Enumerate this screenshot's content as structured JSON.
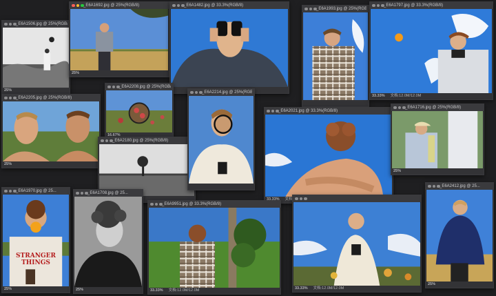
{
  "windows": [
    {
      "title": "_E6A1506.jpg @ 25%(RGB/8)",
      "zoom": "25%",
      "info": ""
    },
    {
      "title": "_E6A1692.jpg @ 25%(RGB/8)",
      "zoom": "25%",
      "info": ""
    },
    {
      "title": "_E6A1482.jpg @ 33.3%(RGB/8)",
      "zoom": "",
      "info": ""
    },
    {
      "title": "_E6A1993.jpg @ 25%(RGB/8)",
      "zoom": "",
      "info": ""
    },
    {
      "title": "_E6A1797.jpg @ 33.3%(RGB/8)",
      "zoom": "33.33%",
      "info": "文档:12.0M/12.0M"
    },
    {
      "title": "_E6A2205.jpg @ 25%(RGB/8)",
      "zoom": "25%",
      "info": ""
    },
    {
      "title": "_E6A2208.jpg @ 25%(RGB/8)",
      "zoom": "16.67%",
      "info": ""
    },
    {
      "title": "_E6A2214.jpg @ 25%(RGB/8)",
      "zoom": "",
      "info": ""
    },
    {
      "title": "_E6A2180.jpg @ 25%(RGB/8)",
      "zoom": "",
      "info": ""
    },
    {
      "title": "_E6A2021.jpg @ 33.3%(RGB/8)",
      "zoom": "33.33%",
      "info": "文档:12.0M/12.0M"
    },
    {
      "title": "_E6A1716.jpg @ 25%(RGB/8)",
      "zoom": "25%",
      "info": ""
    },
    {
      "title": "_E6A1970.jpg @ 25...",
      "zoom": "25%",
      "info": ""
    },
    {
      "title": "_E6A1708.jpg @ 25...",
      "zoom": "25%",
      "info": ""
    },
    {
      "title": "_E6A9951.jpg @ 33.3%(RGB/8)",
      "zoom": "33.33%",
      "info": "文档:12.0M/12.0M"
    },
    {
      "title": "",
      "zoom": "33.33%",
      "info": "文档:12.0M/12.0M"
    },
    {
      "title": "_E6A2412.jpg @ 25...",
      "zoom": "25%",
      "info": ""
    }
  ],
  "sweater_text": "STRANGER THINGS",
  "colors": {
    "chrome": "#3a3a3d",
    "background": "#1f1f21",
    "status": "#333336"
  }
}
